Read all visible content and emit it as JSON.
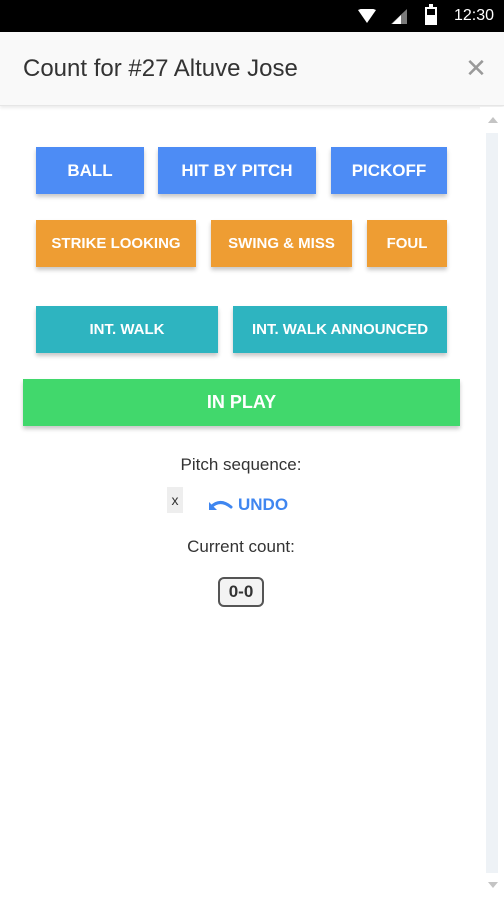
{
  "status_bar": {
    "time": "12:30",
    "icons": [
      "wifi-icon",
      "signal-icon",
      "battery-icon"
    ]
  },
  "header": {
    "title": "Count for #27 Altuve Jose",
    "close_icon": "close-icon"
  },
  "buttons": {
    "ball": "BALL",
    "hit_by_pitch": "HIT BY PITCH",
    "pickoff": "PICKOFF",
    "strike_looking": "STRIKE LOOKING",
    "swing_and_miss": "SWING & MISS",
    "foul": "FOUL",
    "int_walk": "INT. WALK",
    "int_walk_announced": "INT. WALK ANNOUNCED",
    "in_play": "IN PLAY"
  },
  "pitch_sequence": {
    "label": "Pitch sequence:",
    "items": [
      "x"
    ],
    "undo_label": "UNDO",
    "undo_icon": "undo-icon"
  },
  "current_count": {
    "label": "Current count:",
    "value": "0-0"
  },
  "colors": {
    "blue": "#4d8cf5",
    "orange": "#ee9d33",
    "teal": "#2eb4c0",
    "green": "#41d86c",
    "link": "#3f86f0"
  }
}
